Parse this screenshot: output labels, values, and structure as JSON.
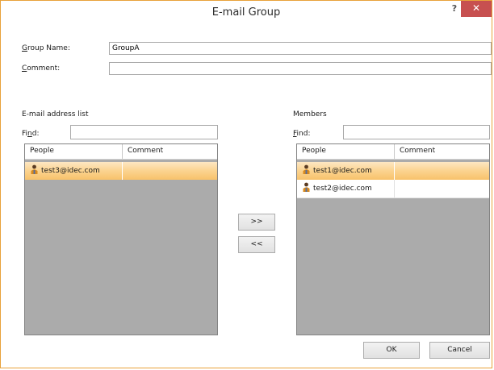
{
  "window": {
    "title": "E-mail Group",
    "help_glyph": "?",
    "close_glyph": "✕"
  },
  "form": {
    "group_name_label_first": "G",
    "group_name_label_rest": "roup Name:",
    "group_name_value": "GroupA",
    "comment_label_first": "C",
    "comment_label_rest": "omment:",
    "comment_value": ""
  },
  "address_list": {
    "title": "E-mail address list",
    "find_label_pre": "Fi",
    "find_label_u": "n",
    "find_label_post": "d:",
    "find_value": "",
    "columns": [
      "People",
      "Comment"
    ],
    "rows": [
      {
        "person": "test3@idec.com",
        "comment": "",
        "selected": true
      }
    ]
  },
  "members": {
    "title": "Members",
    "find_label_u": "F",
    "find_label_post": "ind:",
    "find_value": "",
    "columns": [
      "People",
      "Comment"
    ],
    "rows": [
      {
        "person": "test1@idec.com",
        "comment": "",
        "selected": true
      },
      {
        "person": "test2@idec.com",
        "comment": "",
        "selected": false
      }
    ]
  },
  "transfer": {
    "add_label": ">>",
    "remove_label": "<<"
  },
  "footer": {
    "ok_label": "OK",
    "cancel_label": "Cancel"
  },
  "colors": {
    "accent_border": "#e8a23a",
    "close_bg": "#c75050",
    "selection": "#fbd38f",
    "list_bg": "#ababab"
  }
}
